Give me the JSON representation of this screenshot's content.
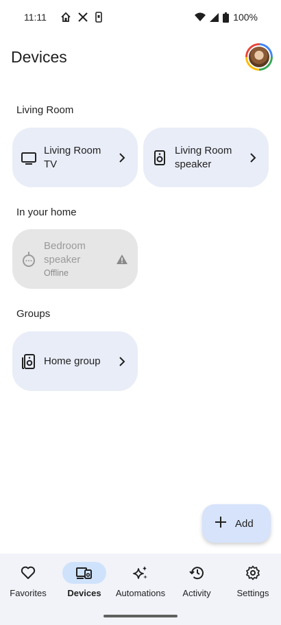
{
  "status_bar": {
    "time": "11:11",
    "battery": "100%",
    "left_icons": [
      "home-icon",
      "x-logo-icon",
      "phone-icon"
    ],
    "right_icons": [
      "wifi-icon",
      "signal-icon",
      "battery-icon"
    ]
  },
  "header": {
    "title": "Devices",
    "avatar": "user-avatar"
  },
  "sections": [
    {
      "title": "Living Room",
      "cards": [
        {
          "label": "Living Room TV",
          "icon": "tv-icon"
        },
        {
          "label": "Living Room speaker",
          "icon": "speaker-icon"
        }
      ]
    },
    {
      "title": "In your home",
      "cards": [
        {
          "label": "Bedroom speaker",
          "status": "Offline",
          "icon": "smart-speaker-icon",
          "alert_icon": "warning-icon"
        }
      ]
    },
    {
      "title": "Groups",
      "cards": [
        {
          "label": "Home group",
          "icon": "speaker-group-icon"
        }
      ]
    }
  ],
  "fab": {
    "label": "Add",
    "icon": "plus-icon"
  },
  "bottom_nav": {
    "active": "Devices",
    "items": [
      {
        "label": "Favorites",
        "icon": "heart-icon"
      },
      {
        "label": "Devices",
        "icon": "devices-icon"
      },
      {
        "label": "Automations",
        "icon": "sparkle-icon"
      },
      {
        "label": "Activity",
        "icon": "history-icon"
      },
      {
        "label": "Settings",
        "icon": "gear-icon"
      }
    ]
  },
  "colors": {
    "card_bg": "#e9edf8",
    "offline_card_bg": "#e6e6e6",
    "fab_bg": "#d6e3fb",
    "nav_bg": "#f1f3f9",
    "nav_active_pill": "#cfe2fc"
  }
}
